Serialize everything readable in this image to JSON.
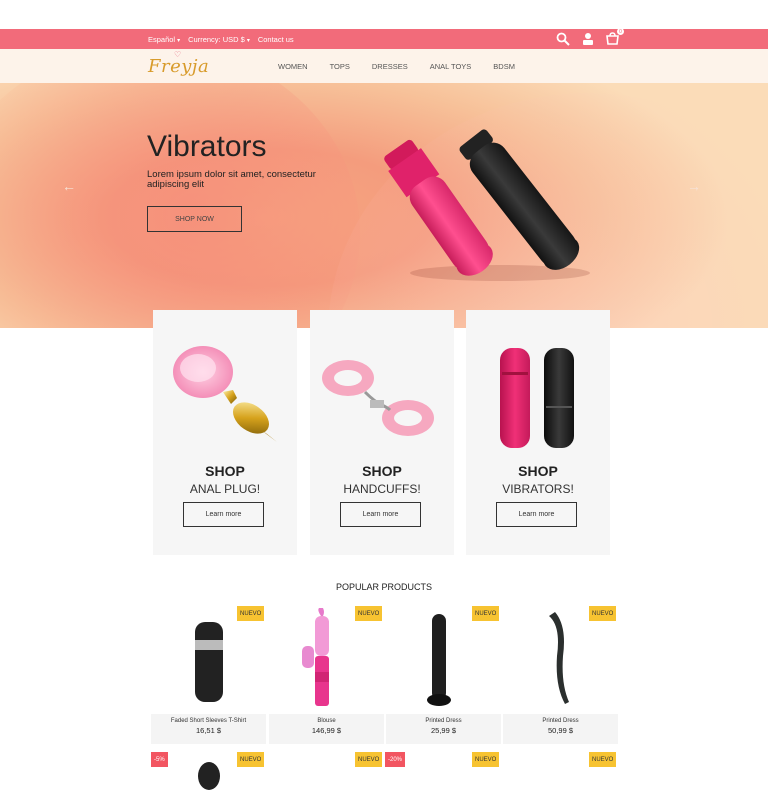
{
  "topbar": {
    "language": "Español",
    "currency": "Currency: USD $",
    "contact": "Contact us",
    "cart_count": "0"
  },
  "header": {
    "logo_text": "Freyja",
    "nav": [
      "WOMEN",
      "TOPS",
      "DRESSES",
      "ANAL TOYS",
      "BDSM"
    ]
  },
  "hero": {
    "title": "Vibrators",
    "subtitle": "Lorem ipsum dolor sit amet, consectetur adipiscing elit",
    "button": "SHOP NOW",
    "prev_icon": "arrow-left-icon",
    "next_icon": "arrow-right-icon"
  },
  "cards": [
    {
      "line1": "SHOP",
      "line2": "ANAL PLUG!",
      "button": "Learn more"
    },
    {
      "line1": "SHOP",
      "line2": "HANDCUFFS!",
      "button": "Learn more"
    },
    {
      "line1": "SHOP",
      "line2": "VIBRATORS!",
      "button": "Learn more"
    }
  ],
  "popular": {
    "heading": "POPULAR PRODUCTS",
    "products": [
      {
        "name": "Faded Short Sleeves T-Shirt",
        "price": "16,51 $",
        "badge": "NUEVO"
      },
      {
        "name": "Blouse",
        "price": "146,99 $",
        "badge": "NUEVO"
      },
      {
        "name": "Printed Dress",
        "price": "25,99 $",
        "badge": "NUEVO"
      },
      {
        "name": "Printed Dress",
        "price": "50,99 $",
        "badge": "NUEVO"
      }
    ],
    "row2_badges": {
      "p1_discount": "-5%",
      "p1_new": "NUEVO",
      "p2_new": "NUEVO",
      "p2_discount": "-20%",
      "p3_new": "NUEVO",
      "p4_new": "NUEVO"
    }
  },
  "colors": {
    "topbar": "#f26b7a",
    "accent_badge": "#f7c331",
    "discount_badge": "#f25561"
  }
}
